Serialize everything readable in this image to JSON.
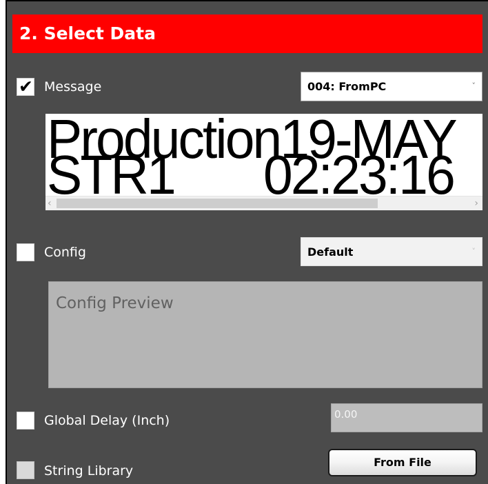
{
  "header": {
    "title": "2. Select Data"
  },
  "message": {
    "checked": true,
    "checkmark": "✔",
    "label": "Message",
    "selected": "004: FromPC",
    "arrow": "˅"
  },
  "preview": {
    "line1": "Production19-MAY",
    "line2": "STR1       02:23:16",
    "scroll_left": "‹",
    "scroll_right": "›"
  },
  "config": {
    "checked": false,
    "label": "Config",
    "selected": "Default",
    "arrow": "˅",
    "preview_text": "Config Preview"
  },
  "global_delay": {
    "checked": false,
    "label": "Global Delay (Inch)",
    "value": "0.00"
  },
  "string_library": {
    "checked": false,
    "label": "String Library",
    "button_label": "From File"
  },
  "colors": {
    "header_bg": "#ff0000",
    "panel_bg": "#4b4b4b"
  }
}
